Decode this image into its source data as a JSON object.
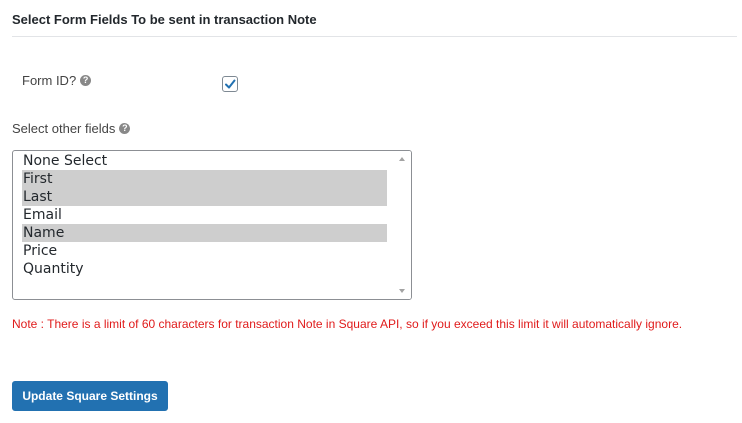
{
  "section": {
    "title": "Select Form Fields To be sent in transaction Note"
  },
  "form_id": {
    "label": "Form ID?",
    "checked": true
  },
  "other_fields": {
    "label": "Select other fields",
    "options": [
      {
        "label": "None Select",
        "selected": false
      },
      {
        "label": "First",
        "selected": true
      },
      {
        "label": "Last",
        "selected": true
      },
      {
        "label": "Email",
        "selected": false
      },
      {
        "label": "Name",
        "selected": true
      },
      {
        "label": "Price",
        "selected": false
      },
      {
        "label": "Quantity",
        "selected": false
      }
    ]
  },
  "note": "Note : There is a limit of 60 characters for transaction Note in Square API, so if you exceed this limit it will automatically ignore.",
  "submit_label": "Update Square Settings",
  "colors": {
    "accent": "#2271b1",
    "note_text": "#e01b1b",
    "selected_option_bg": "#cecece"
  },
  "icons": {
    "help": "question-circle-icon",
    "check": "checkmark-icon"
  }
}
